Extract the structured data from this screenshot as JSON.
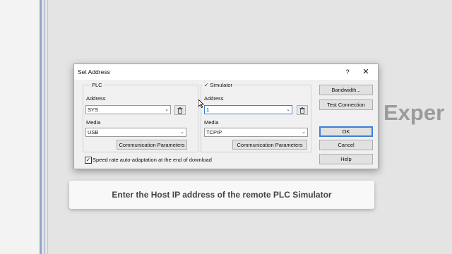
{
  "background": {
    "partial_heading": "Exper"
  },
  "dialog": {
    "title": "Set Address",
    "help_label": "?",
    "close_label": "✕",
    "plc": {
      "group_label": "PLC",
      "address_label": "Address",
      "address_value": "SYS",
      "media_label": "Media",
      "media_value": "USB",
      "comm_params_label": "Communication Parameters"
    },
    "simulator": {
      "checkbox_mark": "✓",
      "group_label": "Simulator",
      "address_label": "Address",
      "address_value": "1",
      "media_label": "Media",
      "media_value": "TCPIP",
      "comm_params_label": "Communication Parameters"
    },
    "buttons": {
      "bandwidth": "Bandwidth...",
      "test_connection": "Test Connection",
      "ok": "OK",
      "cancel": "Cancel",
      "help": "Help"
    },
    "speed_checkbox": {
      "checked_mark": "✓",
      "label": "Speed rate auto-adaptation at the end of download"
    }
  },
  "caption": {
    "text": "Enter the Host IP address of the remote PLC Simulator"
  },
  "colors": {
    "accent": "#3c7fd6",
    "dialog_bg": "#f0f0f0"
  }
}
